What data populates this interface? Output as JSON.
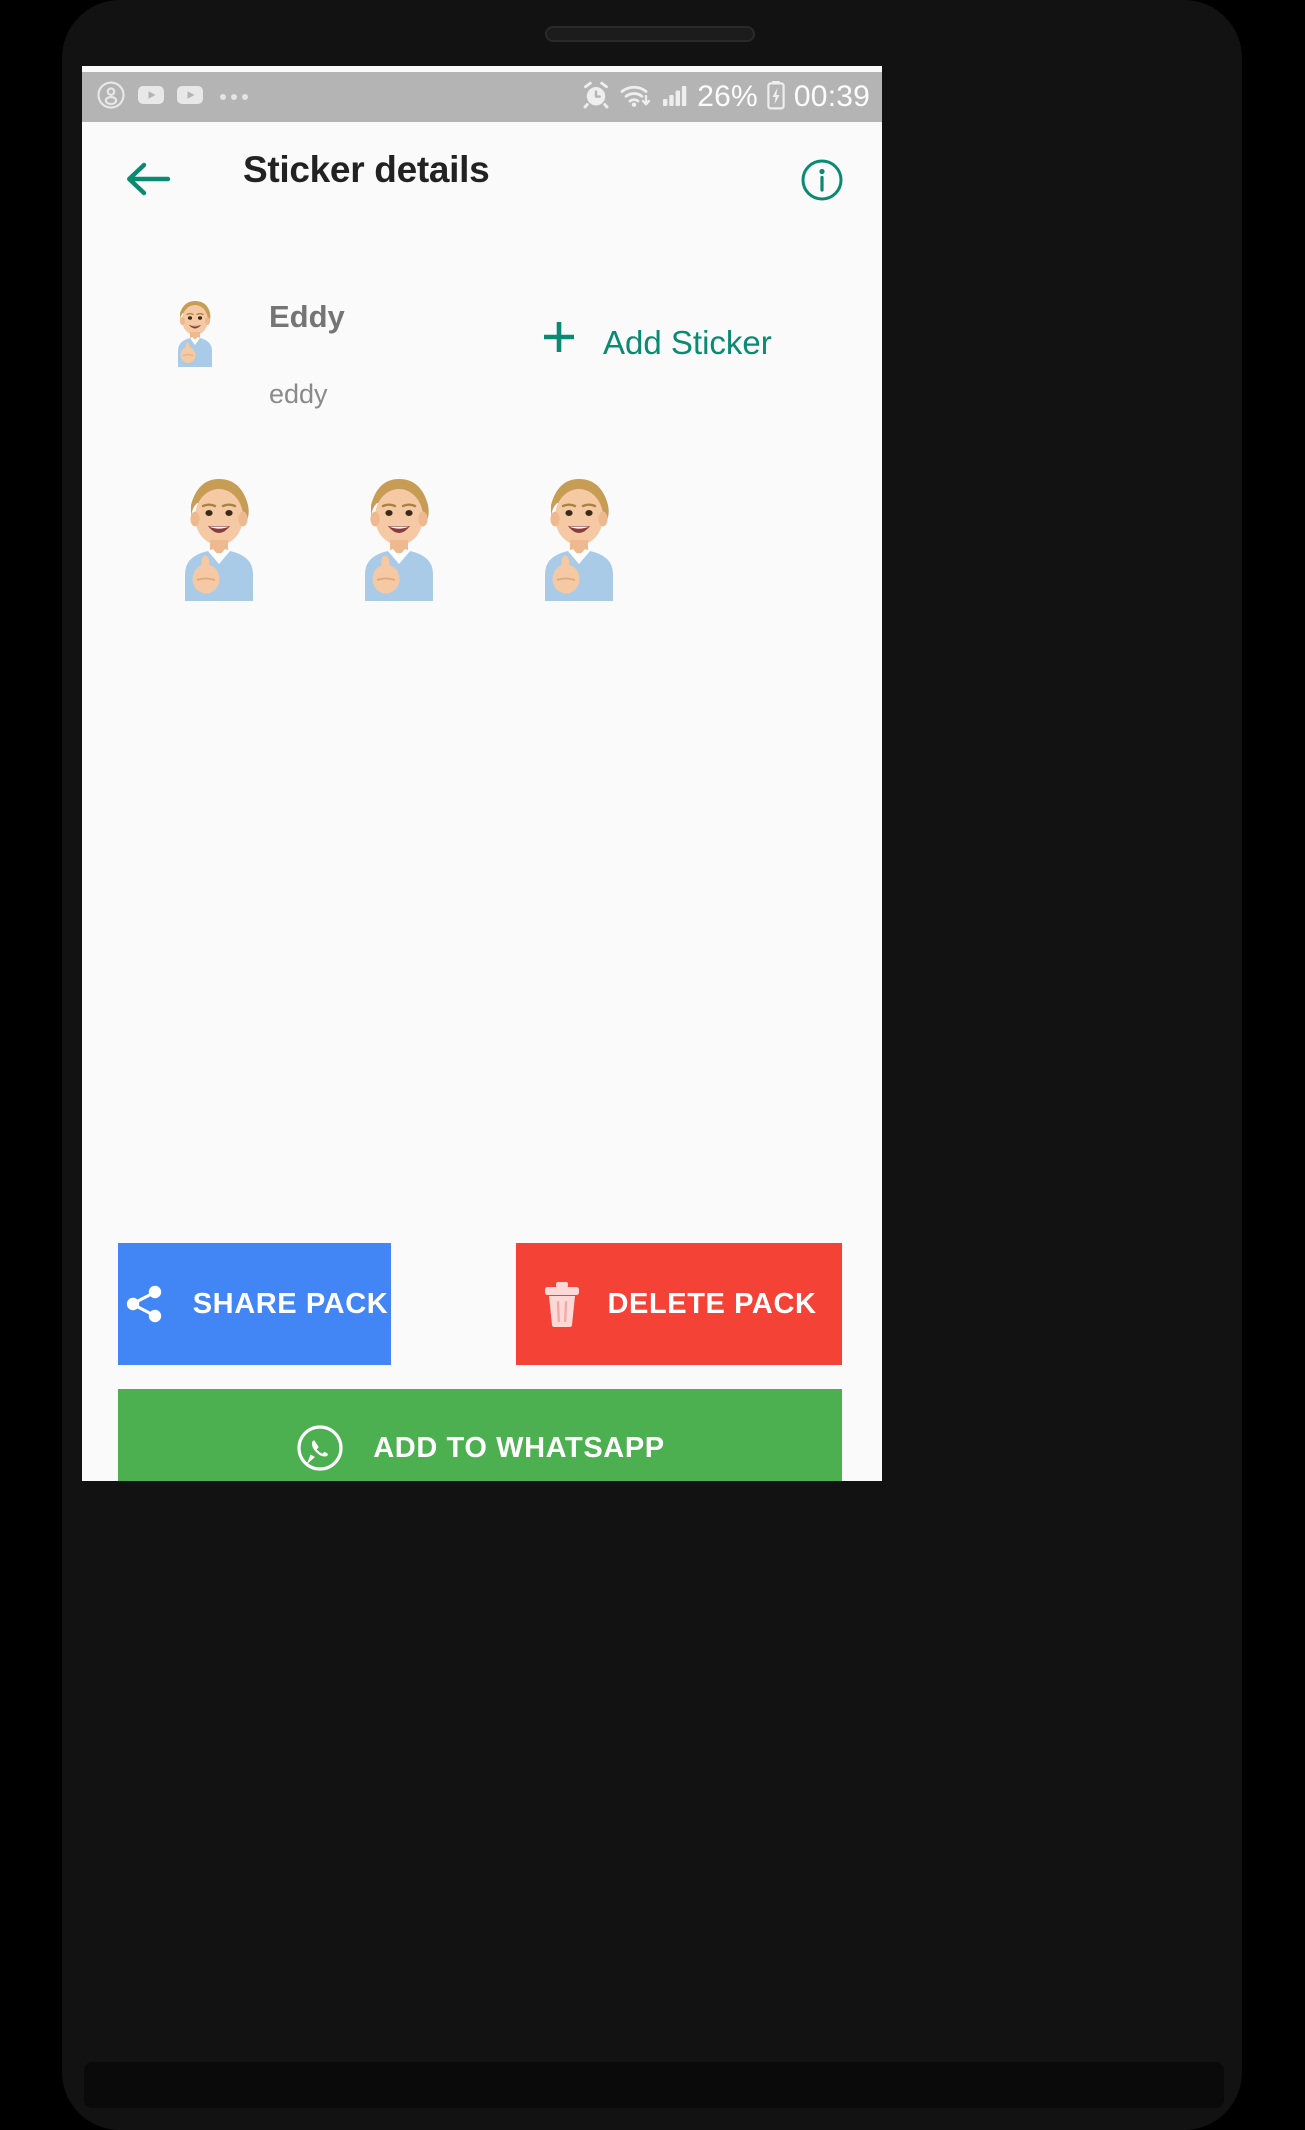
{
  "status_bar": {
    "left_icons": [
      "account-circle-icon",
      "youtube-play-icon",
      "youtube-play-icon",
      "more-dots-icon"
    ],
    "alarm_icon": "alarm-clock-icon",
    "wifi_icon": "wifi-download-icon",
    "signal_icon": "cellular-signal-icon",
    "battery_percent": "26%",
    "battery_icon": "battery-charging-icon",
    "time": "00:39",
    "background_color": "#b4b4b4",
    "foreground_color": "#fcfcfc"
  },
  "app_bar": {
    "back_icon": "arrow-left-icon",
    "title": "Sticker details",
    "info_icon": "info-circle-icon",
    "accent_color": "#0b8a72",
    "title_color": "#222222"
  },
  "pack": {
    "thumbnail_alt": "man-thumbs-up-sticker",
    "name": "Eddy",
    "publisher": "eddy",
    "add_sticker": {
      "plus_icon": "plus-icon",
      "label": "Add Sticker"
    }
  },
  "stickers": [
    {
      "alt": "man-thumbs-up-sticker-1"
    },
    {
      "alt": "man-thumbs-up-sticker-2"
    },
    {
      "alt": "man-thumbs-up-sticker-3"
    }
  ],
  "actions": {
    "share": {
      "label": "SHARE PACK",
      "icon": "share-icon",
      "color": "#4285f4"
    },
    "delete": {
      "label": "DELETE PACK",
      "icon": "trash-icon",
      "color": "#f44336"
    },
    "whatsapp": {
      "label": "ADD TO WHATSAPP",
      "icon": "whatsapp-icon",
      "color": "#4caf50"
    }
  }
}
